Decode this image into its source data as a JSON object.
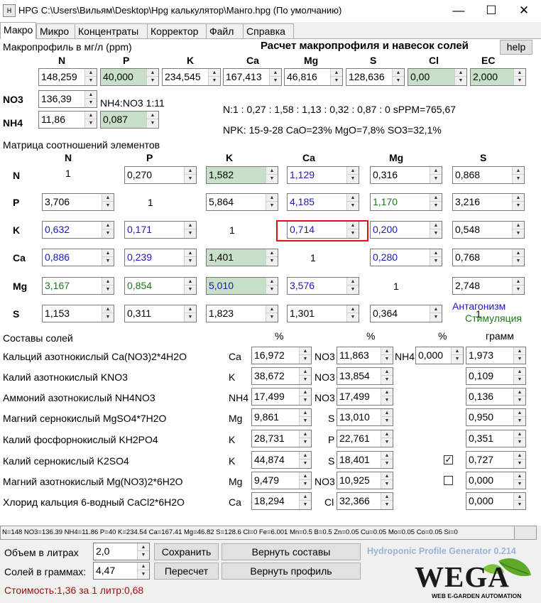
{
  "window": {
    "title": "HPG C:\\Users\\Вильям\\Desktop\\Hpg калькулятор\\Манго.hpg (По умолчанию)",
    "icon": "app-icon",
    "min": "—",
    "max": "☐",
    "close": "✕"
  },
  "tabs": [
    "Макро",
    "Микро",
    "Концентраты",
    "Корректор",
    "Файл",
    "Справка"
  ],
  "macro": {
    "label": "Макропрофиль в мг/л (ppm)",
    "calc_title": "Расчет макропрофиля и навесок солей",
    "help": "help",
    "headers": [
      "N",
      "P",
      "K",
      "Ca",
      "Mg",
      "S",
      "Cl",
      "EC"
    ],
    "values": [
      "148,259",
      "40,000",
      "234,545",
      "167,413",
      "46,816",
      "128,636",
      "0,00",
      "2,000"
    ]
  },
  "nitrogen": {
    "no3_label": "NO3",
    "no3_value": "136,39",
    "nh4_label": "NH4",
    "nh4_value": "11,86",
    "nh4_extra": "0,087",
    "ratio": "NH4:NO3 1:11"
  },
  "ratios_line": "N:1 : 0,27 : 1,58 : 1,13 : 0,32 : 0,87 : 0 sPPM=765,67",
  "npk_line": "NPK: 15-9-28 CaO=23% MgO=7,8% SO3=32,1%",
  "matrix": {
    "label": "Матрица соотношений элементов",
    "headers": [
      "N",
      "P",
      "K",
      "Ca",
      "Mg",
      "S"
    ],
    "rows": [
      "N",
      "P",
      "K",
      "Ca",
      "Mg",
      "S"
    ],
    "cells": [
      [
        "1",
        "0,270",
        "1,582",
        "1,129",
        "0,316",
        "0,868"
      ],
      [
        "3,706",
        "1",
        "5,864",
        "4,185",
        "1,170",
        "3,216"
      ],
      [
        "0,632",
        "0,171",
        "1",
        "0,714",
        "0,200",
        "0,548"
      ],
      [
        "0,886",
        "0,239",
        "1,401",
        "1",
        "0,280",
        "0,768"
      ],
      [
        "3,167",
        "0,854",
        "5,010",
        "3,576",
        "1",
        "2,748"
      ],
      [
        "1,153",
        "0,311",
        "1,823",
        "1,301",
        "0,364",
        "1"
      ]
    ],
    "antag": "Антагонизм",
    "stim": "Стимуляция"
  },
  "salts": {
    "label": "Составы солей",
    "pct": "%",
    "gram": "грамм",
    "rows": [
      {
        "name": "Кальций азотнокислый Ca(NO3)2*4H2O",
        "e1": "Ca",
        "v1": "16,972",
        "e2": "NO3",
        "v2": "11,863",
        "e3": "NH4",
        "v3": "0,000",
        "g": "1,973"
      },
      {
        "name": "Калий азотнокислый KNO3",
        "e1": "K",
        "v1": "38,672",
        "e2": "NO3",
        "v2": "13,854",
        "g": "0,109"
      },
      {
        "name": "Аммоний азотнокислый NH4NO3",
        "e1": "NH4",
        "v1": "17,499",
        "e2": "NO3",
        "v2": "17,499",
        "g": "0,136"
      },
      {
        "name": "Магний сернокислый MgSO4*7H2O",
        "e1": "Mg",
        "v1": "9,861",
        "e2": "S",
        "v2": "13,010",
        "g": "0,950"
      },
      {
        "name": "Калий фосфорнокислый KH2PO4",
        "e1": "K",
        "v1": "28,731",
        "e2": "P",
        "v2": "22,761",
        "g": "0,351"
      },
      {
        "name": "Калий сернокислый K2SO4",
        "e1": "K",
        "v1": "44,874",
        "e2": "S",
        "v2": "18,401",
        "chk": "✓",
        "g": "0,727"
      },
      {
        "name": "Магний азотнокислый Mg(NO3)2*6H2O",
        "e1": "Mg",
        "v1": "9,479",
        "e2": "NO3",
        "v2": "10,925",
        "chk": "",
        "g": "0,000"
      },
      {
        "name": "Хлорид кальция 6-водный CaCl2*6H2O",
        "e1": "Ca",
        "v1": "18,294",
        "e2": "Cl",
        "v2": "32,366",
        "g": "0,000"
      }
    ]
  },
  "status": "N=148 NO3=136.39 NH4=11.86 P=40 K=234.54 Ca=167.41 Mg=46.82 S=128.6 Cl=0 Fe=6.001 Mn=0.5 B=0.5 Zn=0.05 Cu=0.05 Mo=0.05 Co=0.05 Si=0",
  "bottom": {
    "volume_label": "Объем в литрах",
    "volume": "2,0",
    "salts_label": "Солей в граммах:",
    "salts": "4,47",
    "save": "Сохранить",
    "recalc": "Пересчет",
    "restore_salts": "Вернуть составы",
    "restore_profile": "Вернуть профиль",
    "cost": "Стоимость:1,36 за 1 литр:0,68",
    "generator": "Hydroponic Profile Generator 0.214",
    "logo": "WEGA",
    "logo_sub": "WEB E-GARDEN AUTOMATION"
  }
}
